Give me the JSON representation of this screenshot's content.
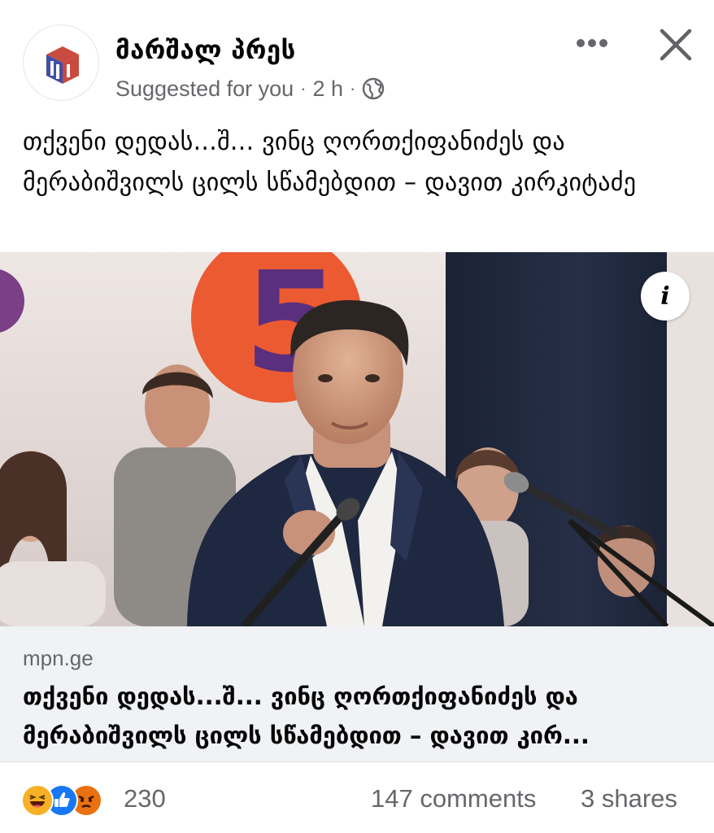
{
  "post": {
    "page_name": "მარშალ პრეს",
    "suggested_label": "Suggested for you",
    "separator": "·",
    "time_ago": "2 h",
    "privacy_icon": "globe-icon",
    "caption": "თქვენი დედას...შ... ვინც ღორთქიფანიძეს და მერაბიშვილს ცილს სწამებდით – დავით კირკიტაძე"
  },
  "link_preview": {
    "domain": "mpn.ge",
    "title": "თქვენი დედას...შ... ვინც ღორთქიფანიძეს და მერაბიშვილს ცილს სწამებდით – დავით კირ..."
  },
  "photo": {
    "info_label": "i",
    "backdrop_number": "5"
  },
  "engagement": {
    "reaction_icons": [
      "haha-icon",
      "like-icon",
      "angry-icon"
    ],
    "reaction_count": "230",
    "comments": "147 comments",
    "shares": "3 shares"
  },
  "colors": {
    "secondary_text": "#65676b",
    "link_background": "#f0f2f5",
    "like_blue": "#1877f2",
    "haha_yellow": "#f7b125",
    "angry_orange": "#e9710f"
  }
}
